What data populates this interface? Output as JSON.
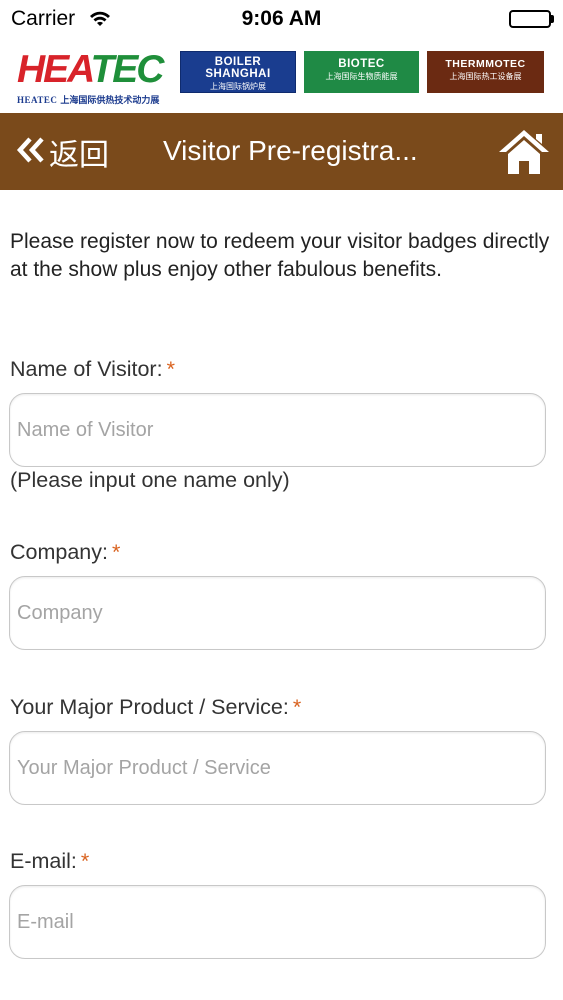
{
  "status_bar": {
    "carrier": "Carrier",
    "time": "9:06 AM",
    "battery_level": 1.0
  },
  "brands": {
    "heatec": {
      "word_part1": "HEA",
      "word_part2": "TEC",
      "en": "HEATEC",
      "zh": "上海国际供热技术动力展"
    },
    "boiler": {
      "line1": "BOILER",
      "line2": "SHANGHAI",
      "zh": "上海国际锅炉展"
    },
    "biotec": {
      "en": "BIOTEC",
      "zh": "上海国际生物质能展"
    },
    "thermmotec": {
      "en": "THERMMOTEC",
      "zh": "上海国际热工设备展"
    },
    "colors": {
      "heatec_red": "#d8232a",
      "heatec_green": "#1f8f3a",
      "boiler_blue": "#1a3d8f",
      "biotec_green": "#1f8a45",
      "thermo_brown": "#6b2a12"
    }
  },
  "nav": {
    "back_label": "返回",
    "title": "Visitor Pre-registra...",
    "background": "#7a4a1b",
    "back_icon": "double-chevron-left-icon",
    "home_icon": "home-icon"
  },
  "intro": "Please register now to redeem your visitor badges directly at the show plus enjoy other fabulous benefits.",
  "form": {
    "required_marker": "*",
    "name": {
      "label": "Name of Visitor:",
      "placeholder": "Name of Visitor",
      "hint": "(Please input one name only)"
    },
    "company": {
      "label": "Company:",
      "placeholder": "Company"
    },
    "product": {
      "label": "Your Major Product / Service:",
      "placeholder": "Your Major Product / Service"
    },
    "email": {
      "label": "E-mail:",
      "placeholder": "E-mail"
    }
  }
}
